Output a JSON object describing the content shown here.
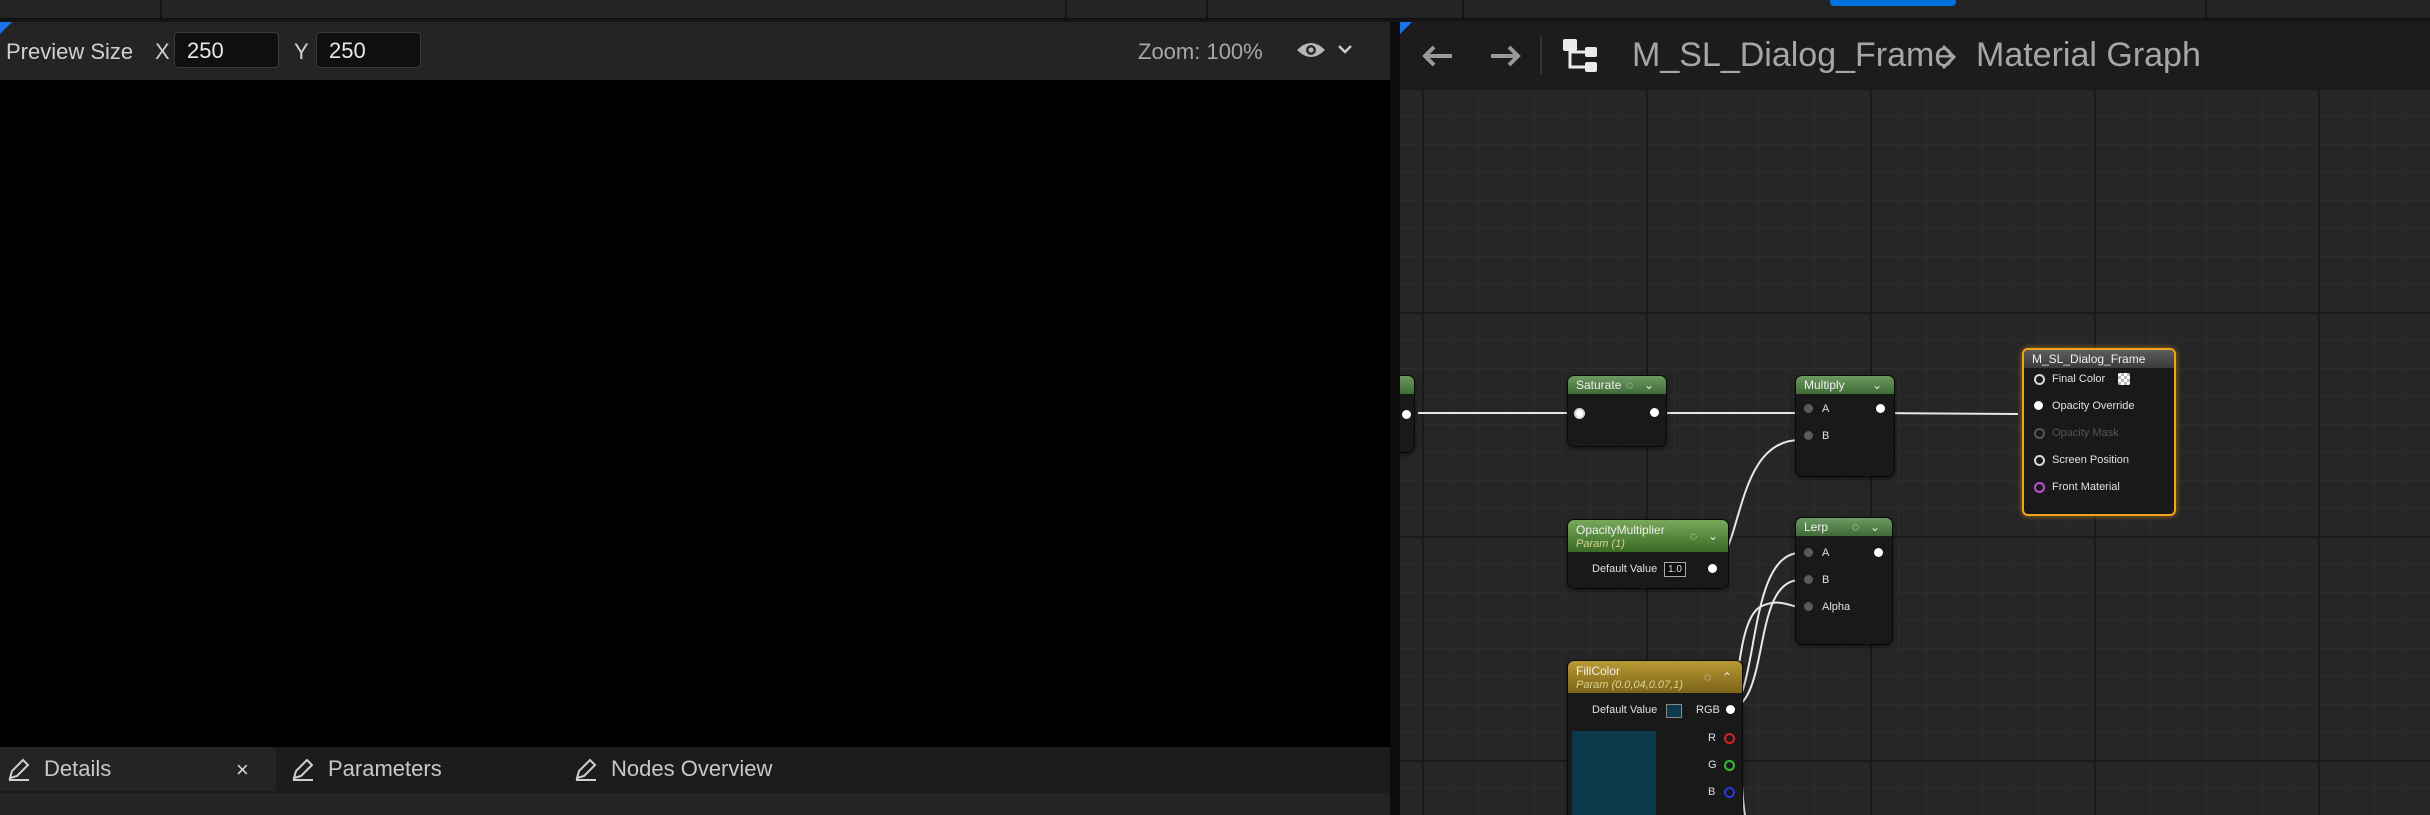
{
  "preview": {
    "size_label": "Preview Size",
    "x_label": "X",
    "x_value": "250",
    "y_label": "Y",
    "y_value": "250",
    "zoom": "Zoom: 100%"
  },
  "bottom_tabs": [
    {
      "label": "Details"
    },
    {
      "label": "Parameters"
    },
    {
      "label": "Nodes Overview"
    }
  ],
  "close_glyph": "×",
  "breadcrumb": {
    "asset": "M_SL_Dialog_Frame",
    "separator": ">",
    "graph": "Material Graph"
  },
  "nodes": {
    "saturate": {
      "title": "Saturate"
    },
    "multiply": {
      "title": "Multiply",
      "pins": [
        "A",
        "B"
      ]
    },
    "opacity_multiplier": {
      "title": "OpacityMultiplier",
      "subtitle": "Param (1)",
      "default_label": "Default Value",
      "default_value": "1.0"
    },
    "lerp": {
      "title": "Lerp",
      "pins": [
        "A",
        "B",
        "Alpha"
      ]
    },
    "fill_color": {
      "title": "FillColor",
      "subtitle": "Param (0.0,04,0.07,1)",
      "default_label": "Default Value",
      "outputs": [
        "RGB",
        "R",
        "G",
        "B"
      ],
      "swatch_color": "#0c3a4a"
    },
    "output": {
      "title": "M_SL_Dialog_Frame",
      "pins": [
        "Final Color",
        "Opacity Override",
        "Opacity Mask",
        "Screen Position",
        "Front Material"
      ]
    }
  },
  "colors": {
    "accent_blue": "#0070e0",
    "output_border": "#f3a21a",
    "pin_purple": "#c04fd8",
    "pin_red": "#d82020",
    "pin_green": "#2fbf2f",
    "pin_blue": "#2a3ad8"
  }
}
